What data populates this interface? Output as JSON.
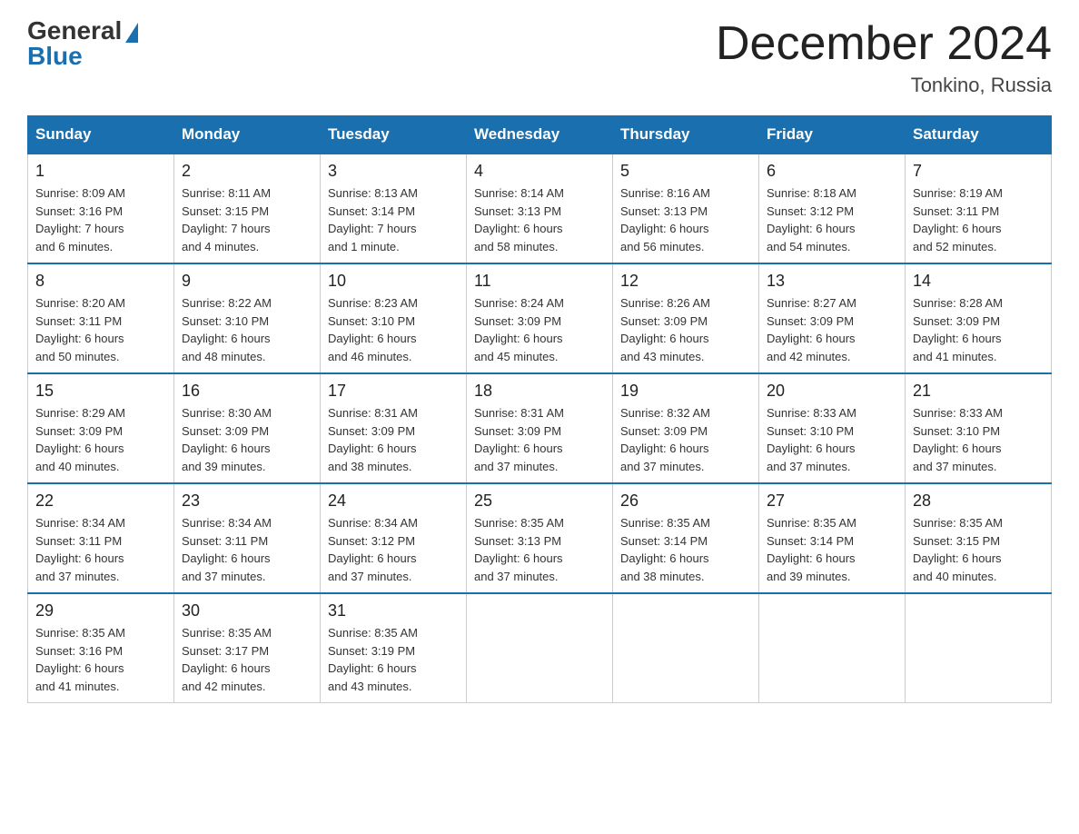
{
  "logo": {
    "general": "General",
    "blue": "Blue"
  },
  "header": {
    "month": "December 2024",
    "location": "Tonkino, Russia"
  },
  "weekdays": [
    "Sunday",
    "Monday",
    "Tuesday",
    "Wednesday",
    "Thursday",
    "Friday",
    "Saturday"
  ],
  "weeks": [
    [
      {
        "day": "1",
        "sunrise": "8:09 AM",
        "sunset": "3:16 PM",
        "daylight": "7 hours and 6 minutes."
      },
      {
        "day": "2",
        "sunrise": "8:11 AM",
        "sunset": "3:15 PM",
        "daylight": "7 hours and 4 minutes."
      },
      {
        "day": "3",
        "sunrise": "8:13 AM",
        "sunset": "3:14 PM",
        "daylight": "7 hours and 1 minute."
      },
      {
        "day": "4",
        "sunrise": "8:14 AM",
        "sunset": "3:13 PM",
        "daylight": "6 hours and 58 minutes."
      },
      {
        "day": "5",
        "sunrise": "8:16 AM",
        "sunset": "3:13 PM",
        "daylight": "6 hours and 56 minutes."
      },
      {
        "day": "6",
        "sunrise": "8:18 AM",
        "sunset": "3:12 PM",
        "daylight": "6 hours and 54 minutes."
      },
      {
        "day": "7",
        "sunrise": "8:19 AM",
        "sunset": "3:11 PM",
        "daylight": "6 hours and 52 minutes."
      }
    ],
    [
      {
        "day": "8",
        "sunrise": "8:20 AM",
        "sunset": "3:11 PM",
        "daylight": "6 hours and 50 minutes."
      },
      {
        "day": "9",
        "sunrise": "8:22 AM",
        "sunset": "3:10 PM",
        "daylight": "6 hours and 48 minutes."
      },
      {
        "day": "10",
        "sunrise": "8:23 AM",
        "sunset": "3:10 PM",
        "daylight": "6 hours and 46 minutes."
      },
      {
        "day": "11",
        "sunrise": "8:24 AM",
        "sunset": "3:09 PM",
        "daylight": "6 hours and 45 minutes."
      },
      {
        "day": "12",
        "sunrise": "8:26 AM",
        "sunset": "3:09 PM",
        "daylight": "6 hours and 43 minutes."
      },
      {
        "day": "13",
        "sunrise": "8:27 AM",
        "sunset": "3:09 PM",
        "daylight": "6 hours and 42 minutes."
      },
      {
        "day": "14",
        "sunrise": "8:28 AM",
        "sunset": "3:09 PM",
        "daylight": "6 hours and 41 minutes."
      }
    ],
    [
      {
        "day": "15",
        "sunrise": "8:29 AM",
        "sunset": "3:09 PM",
        "daylight": "6 hours and 40 minutes."
      },
      {
        "day": "16",
        "sunrise": "8:30 AM",
        "sunset": "3:09 PM",
        "daylight": "6 hours and 39 minutes."
      },
      {
        "day": "17",
        "sunrise": "8:31 AM",
        "sunset": "3:09 PM",
        "daylight": "6 hours and 38 minutes."
      },
      {
        "day": "18",
        "sunrise": "8:31 AM",
        "sunset": "3:09 PM",
        "daylight": "6 hours and 37 minutes."
      },
      {
        "day": "19",
        "sunrise": "8:32 AM",
        "sunset": "3:09 PM",
        "daylight": "6 hours and 37 minutes."
      },
      {
        "day": "20",
        "sunrise": "8:33 AM",
        "sunset": "3:10 PM",
        "daylight": "6 hours and 37 minutes."
      },
      {
        "day": "21",
        "sunrise": "8:33 AM",
        "sunset": "3:10 PM",
        "daylight": "6 hours and 37 minutes."
      }
    ],
    [
      {
        "day": "22",
        "sunrise": "8:34 AM",
        "sunset": "3:11 PM",
        "daylight": "6 hours and 37 minutes."
      },
      {
        "day": "23",
        "sunrise": "8:34 AM",
        "sunset": "3:11 PM",
        "daylight": "6 hours and 37 minutes."
      },
      {
        "day": "24",
        "sunrise": "8:34 AM",
        "sunset": "3:12 PM",
        "daylight": "6 hours and 37 minutes."
      },
      {
        "day": "25",
        "sunrise": "8:35 AM",
        "sunset": "3:13 PM",
        "daylight": "6 hours and 37 minutes."
      },
      {
        "day": "26",
        "sunrise": "8:35 AM",
        "sunset": "3:14 PM",
        "daylight": "6 hours and 38 minutes."
      },
      {
        "day": "27",
        "sunrise": "8:35 AM",
        "sunset": "3:14 PM",
        "daylight": "6 hours and 39 minutes."
      },
      {
        "day": "28",
        "sunrise": "8:35 AM",
        "sunset": "3:15 PM",
        "daylight": "6 hours and 40 minutes."
      }
    ],
    [
      {
        "day": "29",
        "sunrise": "8:35 AM",
        "sunset": "3:16 PM",
        "daylight": "6 hours and 41 minutes."
      },
      {
        "day": "30",
        "sunrise": "8:35 AM",
        "sunset": "3:17 PM",
        "daylight": "6 hours and 42 minutes."
      },
      {
        "day": "31",
        "sunrise": "8:35 AM",
        "sunset": "3:19 PM",
        "daylight": "6 hours and 43 minutes."
      },
      null,
      null,
      null,
      null
    ]
  ],
  "labels": {
    "sunrise": "Sunrise:",
    "sunset": "Sunset:",
    "daylight": "Daylight:"
  }
}
